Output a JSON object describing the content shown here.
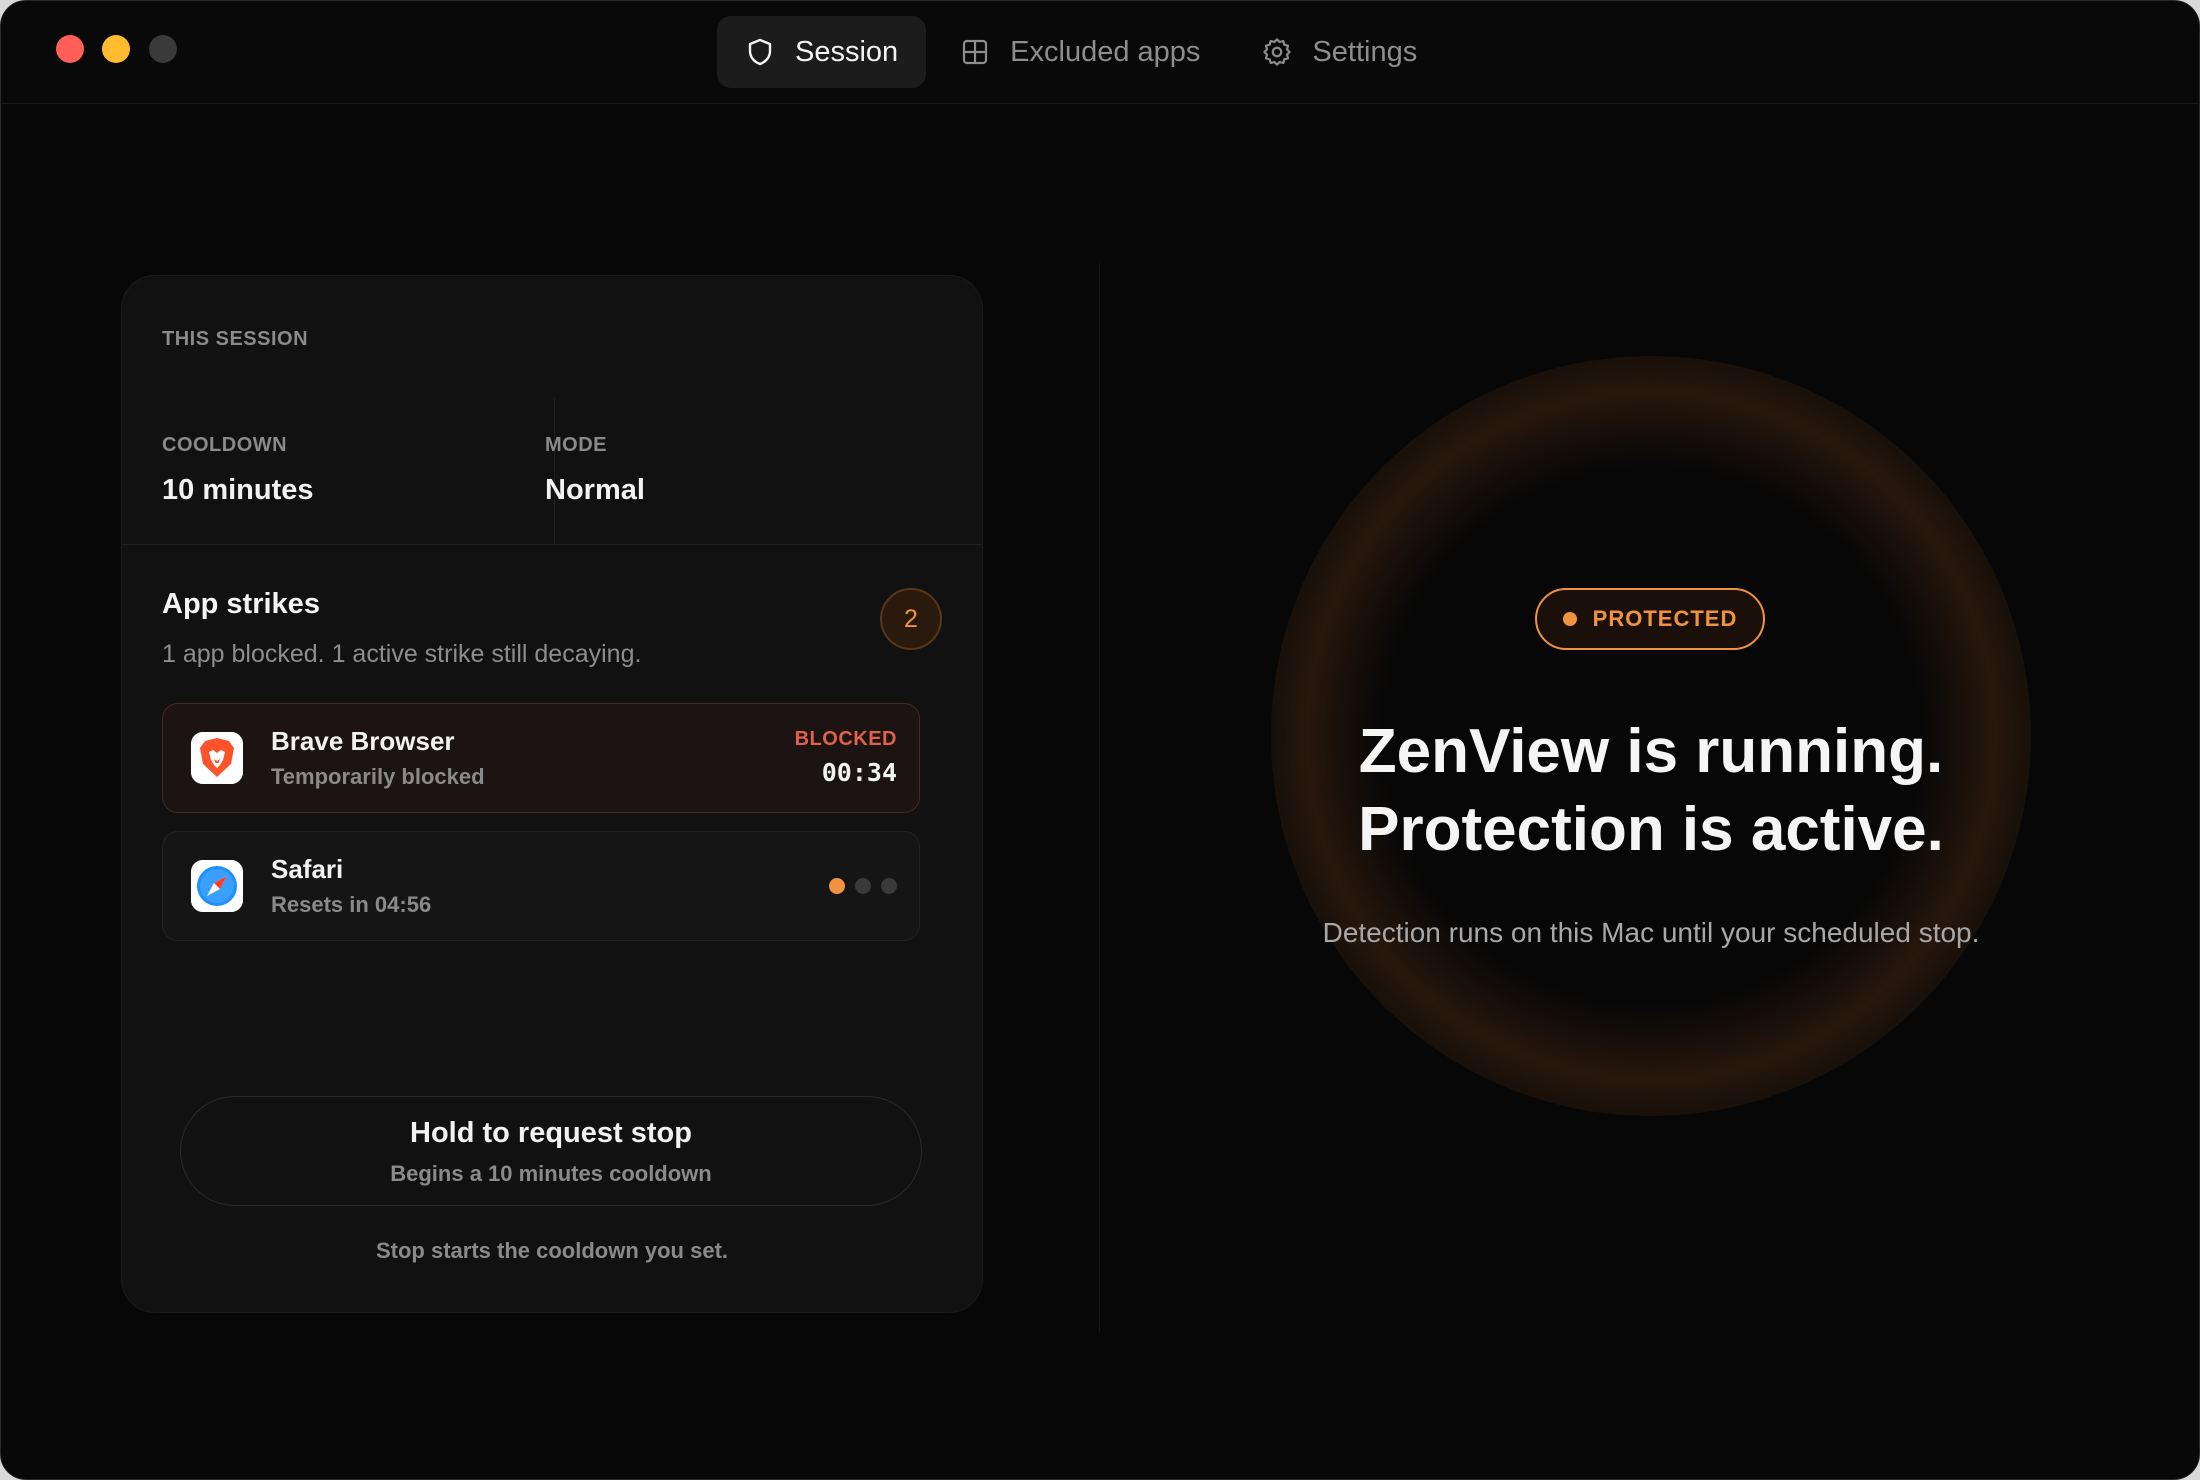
{
  "nav": {
    "tabs": [
      {
        "label": "Session",
        "icon": "shield-icon",
        "active": true
      },
      {
        "label": "Excluded apps",
        "icon": "grid-icon",
        "active": false
      },
      {
        "label": "Settings",
        "icon": "gear-icon",
        "active": false
      }
    ]
  },
  "session": {
    "section_label": "THIS SESSION",
    "cooldown_label": "COOLDOWN",
    "cooldown_value": "10 minutes",
    "mode_label": "MODE",
    "mode_value": "Normal",
    "strikes_title": "App strikes",
    "strikes_summary": "1 app blocked. 1 active strike still decaying.",
    "strike_count": "2",
    "apps": [
      {
        "name": "Brave Browser",
        "status": "Temporarily blocked",
        "tag": "BLOCKED",
        "time": "00:34",
        "icon": "brave-lion-icon"
      },
      {
        "name": "Safari",
        "status": "Resets in 04:56",
        "icon": "safari-compass-icon",
        "strikes_active": 1,
        "strikes_total": 3
      }
    ],
    "hold_button_title": "Hold to request stop",
    "hold_button_sub": "Begins a 10 minutes cooldown",
    "footnote": "Stop starts the cooldown you set."
  },
  "status": {
    "badge": "PROTECTED",
    "headline_line1": "ZenView is running.",
    "headline_line2": "Protection is active.",
    "description": "Detection runs on this Mac until your scheduled stop."
  },
  "colors": {
    "accent": "#f0933f",
    "blocked": "#e0614a",
    "background": "#070707",
    "card": "#111111"
  }
}
